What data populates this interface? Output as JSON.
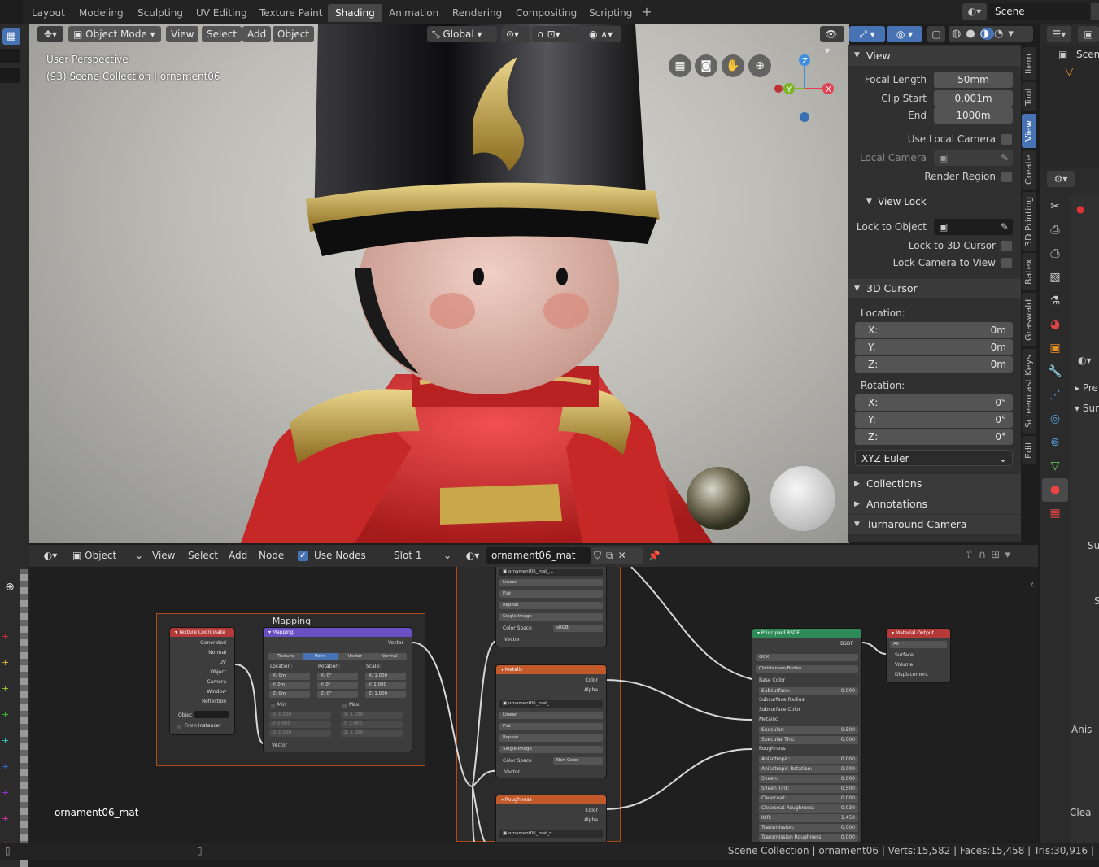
{
  "workspace_tabs": [
    "Layout",
    "Modeling",
    "Sculpting",
    "UV Editing",
    "Texture Paint",
    "Shading",
    "Animation",
    "Rendering",
    "Compositing",
    "Scripting"
  ],
  "active_tab": "Shading",
  "scene_name": "Scene",
  "viewport": {
    "mode": "Object Mode",
    "menus": [
      "View",
      "Select",
      "Add",
      "Object"
    ],
    "transform_orientation": "Global",
    "info_line1": "User Perspective",
    "info_line2": "(93) Scene Collection | ornament06"
  },
  "npanel": {
    "view_header": "View",
    "focal_length_label": "Focal Length",
    "focal_length": "50mm",
    "clip_start_label": "Clip Start",
    "clip_start": "0.001m",
    "end_label": "End",
    "clip_end": "1000m",
    "use_local_camera": "Use Local Camera",
    "local_camera": "Local Camera",
    "render_region": "Render Region",
    "view_lock_header": "View Lock",
    "lock_to_object": "Lock to Object",
    "lock_to_cursor": "Lock to 3D Cursor",
    "lock_camera": "Lock Camera to View",
    "cursor_header": "3D Cursor",
    "location_label": "Location:",
    "loc_x": "0m",
    "loc_y": "0m",
    "loc_z": "0m",
    "rotation_label": "Rotation:",
    "rot_x": "0°",
    "rot_y": "-0°",
    "rot_z": "0°",
    "x_label": "X:",
    "y_label": "Y:",
    "z_label": "Z:",
    "rotation_mode": "XYZ Euler",
    "collections": "Collections",
    "annotations": "Annotations",
    "turnaround": "Turnaround Camera"
  },
  "side_tabs": [
    "Item",
    "Tool",
    "View",
    "Create",
    "3D Printing",
    "Batex",
    "Graswald",
    "Screencast Keys",
    "Edit"
  ],
  "outliner": {
    "scene": "Scene"
  },
  "properties": {
    "pre": "Pre",
    "sur": "Sur",
    "su": "Su",
    "s": "S",
    "anis": "Anis",
    "clea": "Clea"
  },
  "node_editor": {
    "type": "Object",
    "menus": [
      "View",
      "Select",
      "Add",
      "Node"
    ],
    "use_nodes": "Use Nodes",
    "slot": "Slot 1",
    "material": "ornament06_mat",
    "frame_label": "ornament06_mat"
  },
  "nodes": {
    "frame_mapping": "Mapping",
    "texcoord": {
      "title": "Texture Coordinate",
      "outputs": [
        "Generated",
        "Normal",
        "UV",
        "Object",
        "Camera",
        "Window",
        "Reflection"
      ],
      "object_label": "Objec",
      "from_instancer": "From Instancer"
    },
    "mapping": {
      "title": "Mapping",
      "vector_out": "Vector",
      "types": [
        "Texture",
        "Point",
        "Vector",
        "Normal"
      ],
      "location": "Location:",
      "rotation": "Rotation:",
      "scale": "Scale:",
      "lx": "X: 0m",
      "ly": "Y: 0m",
      "lz": "Z: 0m",
      "rx": "X: 0°",
      "ry": "Y: 0°",
      "rz": "Z: 0°",
      "sx": "X: 1.000",
      "sy": "Y: 1.000",
      "sz": "Z: 1.000",
      "min": "Min",
      "max": "Max",
      "minx": "X: 0.000",
      "miny": "Y: 0.000",
      "minz": "Z: 0.000",
      "maxx": "X: 1.000",
      "maxy": "Y: 1.000",
      "maxz": "Z: 1.000",
      "vector_in": "Vector"
    },
    "tex1": {
      "img": "ornament06_mat_...",
      "linear": "Linear",
      "flat": "Flat",
      "repeat": "Repeat",
      "single": "Single Image",
      "cs_label": "Color Space",
      "cs": "sRGB",
      "vector": "Vector"
    },
    "metalic": {
      "title": "Metalic",
      "color": "Color",
      "alpha": "Alpha",
      "img": "ornament06_mat_...",
      "linear": "Linear",
      "flat": "Flat",
      "repeat": "Repeat",
      "single": "Single Image",
      "cs_label": "Color Space",
      "cs": "Non-Color",
      "vector": "Vector"
    },
    "roughness": {
      "title": "Roughness",
      "color": "Color",
      "alpha": "Alpha",
      "img": "ornament06_mat_r..."
    },
    "bsdf": {
      "title": "Principled BSDF",
      "out": "BSDF",
      "dist": "GGX",
      "sss": "Christensen-Burley",
      "rows": [
        [
          "Base Color",
          ""
        ],
        [
          "Subsurface:",
          "0.000"
        ],
        [
          "Subsurface Radius",
          ""
        ],
        [
          "Subsurface Color",
          ""
        ],
        [
          "Metallic",
          ""
        ],
        [
          "Specular:",
          "0.500"
        ],
        [
          "Specular Tint:",
          "0.000"
        ],
        [
          "Roughness",
          ""
        ],
        [
          "Anisotropic:",
          "0.000"
        ],
        [
          "Anisotropic Rotation:",
          "0.000"
        ],
        [
          "Sheen:",
          "0.000"
        ],
        [
          "Sheen Tint:",
          "0.500"
        ],
        [
          "Clearcoat:",
          "0.000"
        ],
        [
          "Clearcoat Roughness:",
          "0.030"
        ],
        [
          "IOR:",
          "1.450"
        ],
        [
          "Transmission:",
          "0.000"
        ],
        [
          "Transmission Roughness:",
          "0.000"
        ]
      ]
    },
    "output": {
      "title": "Material Output",
      "target": "All",
      "inputs": [
        "Surface",
        "Volume",
        "Displacement"
      ]
    }
  },
  "status_bar": "Scene Collection | ornament06 | Verts:15,582 | Faces:15,458 | Tris:30,916 |"
}
